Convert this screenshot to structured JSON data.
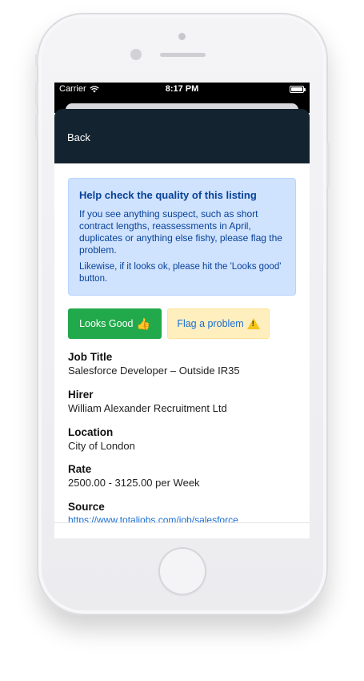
{
  "status_bar": {
    "carrier": "Carrier",
    "time": "8:17 PM"
  },
  "header": {
    "back_label": "Back"
  },
  "notice": {
    "title": "Help check the quality of this listing",
    "paragraph1": "If you see anything suspect, such as short contract lengths, reassessments in April, duplicates or anything else fishy, please flag the problem.",
    "paragraph2": "Likewise, if it looks ok, please hit the 'Looks good' button."
  },
  "actions": {
    "looks_good_label": "Looks Good",
    "flag_label": "Flag a problem"
  },
  "fields": {
    "job_title": {
      "label": "Job Title",
      "value": "Salesforce Developer – Outside IR35"
    },
    "hirer": {
      "label": "Hirer",
      "value": "William Alexander Recruitment Ltd"
    },
    "location": {
      "label": "Location",
      "value": "City of London"
    },
    "rate": {
      "label": "Rate",
      "value": "2500.00 - 3125.00 per Week"
    },
    "source": {
      "label": "Source",
      "value": "https://www.totaljobs.com/job/salesforce"
    }
  },
  "colors": {
    "header_bg": "#13232f",
    "notice_bg": "#cfe2fe",
    "notice_text": "#084298",
    "good_button": "#22a94b",
    "flag_button": "#ffefbf",
    "link": "#1a6fd4"
  },
  "icons": [
    "wifi-icon",
    "battery-icon",
    "thumbs-up-icon",
    "warning-icon"
  ]
}
